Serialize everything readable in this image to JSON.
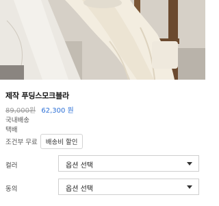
{
  "product": {
    "name": "제작 푸딩스모크블라",
    "original_price": "89,000원",
    "sale_price": "62,300 원",
    "shipping_region": "국내배송",
    "shipping_method": "택배",
    "shipping_condition": "조건부 무료",
    "shipping_discount_button": "배송비 할인"
  },
  "options": [
    {
      "label": "컬러",
      "selected": "옵션 선택"
    },
    {
      "label": "동의",
      "selected": "옵션 선택"
    }
  ],
  "colors": {
    "sale_price": "#2b6fd6",
    "original_price": "#999999"
  }
}
